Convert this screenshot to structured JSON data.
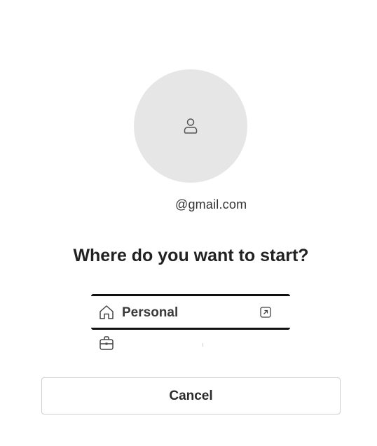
{
  "account": {
    "email": "@gmail.com",
    "avatar_icon": "person-icon"
  },
  "prompt": {
    "heading": "Where do you want to start?"
  },
  "options": [
    {
      "label": "Personal",
      "icon": "home-icon",
      "trailing_icon": "open-external-icon"
    },
    {
      "label": "",
      "icon": "briefcase-icon"
    }
  ],
  "actions": {
    "cancel_label": "Cancel"
  },
  "colors": {
    "avatar_bg": "#e6e6e6",
    "text": "#222222",
    "border_selected": "#111111",
    "button_border": "#cfcfcf"
  }
}
